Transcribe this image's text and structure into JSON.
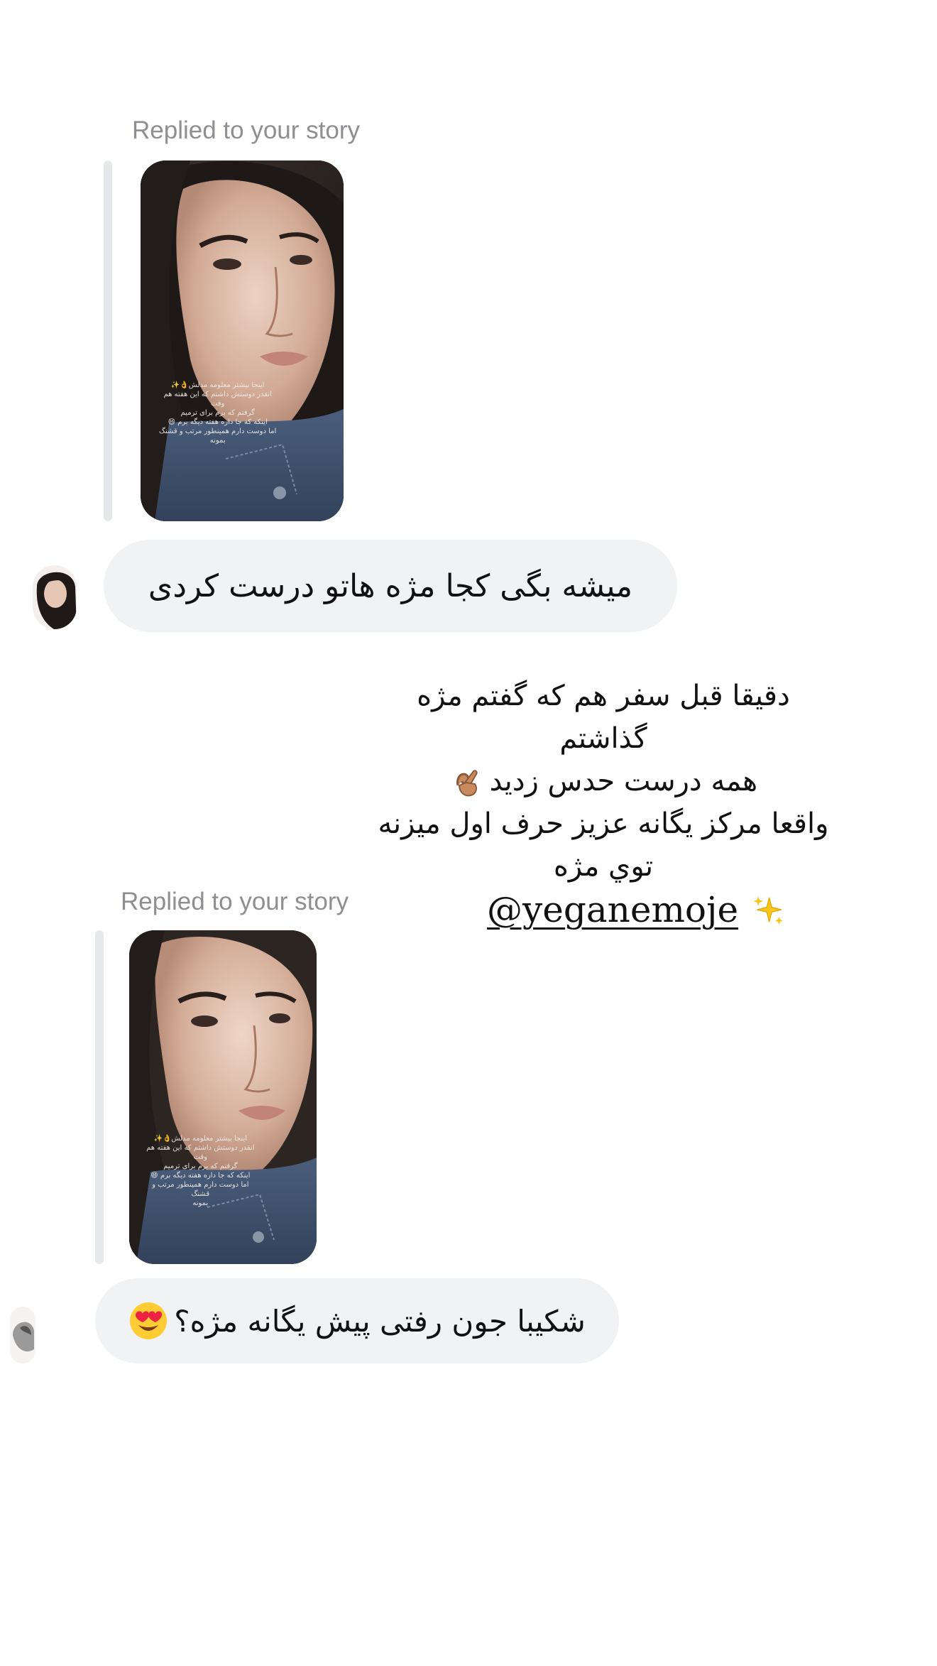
{
  "thread": {
    "messages": [
      {
        "reply_label": "Replied to your story",
        "story_overlay_lines": [
          "اینجا بیشتر معلومه مدلش👌✨",
          "انقدر دوستش داشتم که این هفته هم وقت",
          "گرفتم که برم برای ترمیم",
          "اینکه که جا داره هفته دیگه برم 😄",
          "اما دوست دارم همینطور مرتب و قشنگ",
          "بمونه"
        ],
        "text": "میشه بگی کجا مژه هاتو درست کردی"
      },
      {
        "reply_label": "Replied to your story",
        "story_overlay_lines": [
          "اینجا بیشتر معلومه مدلش👌✨",
          "انقدر دوستش داشتم که این هفته هم وقت",
          "گرفتم که برم برای ترمیم",
          "اینکه که جا داره هفته دیگه برم 😄",
          "اما دوست دارم همینطور مرتب و قشنگ",
          "بمونه"
        ],
        "text": "شکیبا جون رفتی پیش یگانه مژه؟",
        "emoji": "heart-eyes"
      }
    ]
  },
  "story_text": {
    "lines": [
      "دقیقا قبل سفر هم که گفتم مژه",
      "گذاشتم",
      "همه درست حدس زدید",
      "واقعا مرکز یگانه عزیز حرف اول میزنه",
      "توي مژه"
    ],
    "ok_emoji_line_index": 2,
    "mention": "@yeganemoje",
    "mention_icon": "sparkles"
  },
  "colors": {
    "bubble": "#f1f2f4",
    "quote_bar": "#e7e8eb",
    "label": "#8e8e93",
    "text": "#111111"
  }
}
